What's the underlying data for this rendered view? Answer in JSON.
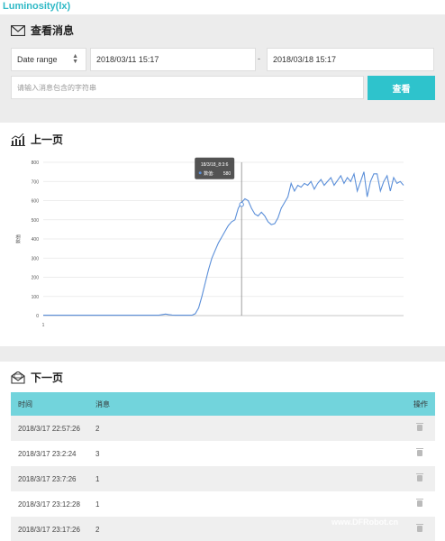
{
  "app_title": "Luminosity(lx)",
  "filter": {
    "title": "查看消息",
    "range_label": "Date range",
    "date_from": "2018/03/11 15:17",
    "separator": "-",
    "date_to": "2018/03/18 15:17",
    "search_placeholder": "请输入消息包含的字符串",
    "search_button": "查看"
  },
  "chart_section": {
    "title": "上一页"
  },
  "chart_data": {
    "type": "line",
    "ylabel": "数值",
    "ylim": [
      0,
      800
    ],
    "yticks": [
      0,
      100,
      200,
      300,
      400,
      500,
      600,
      700,
      800
    ],
    "x_tick_label": "1",
    "series": [
      {
        "name": "数值",
        "values": [
          2,
          2,
          2,
          2,
          2,
          2,
          2,
          2,
          2,
          2,
          2,
          2,
          2,
          2,
          2,
          2,
          2,
          2,
          2,
          2,
          2,
          2,
          2,
          2,
          2,
          2,
          2,
          2,
          2,
          2,
          2,
          2,
          2,
          2,
          2,
          2,
          5,
          8,
          5,
          3,
          2,
          2,
          2,
          2,
          2,
          2,
          10,
          40,
          100,
          170,
          240,
          300,
          340,
          380,
          410,
          440,
          470,
          490,
          500,
          560,
          590,
          610,
          600,
          560,
          530,
          520,
          540,
          520,
          490,
          475,
          480,
          510,
          560,
          590,
          620,
          690,
          650,
          680,
          670,
          690,
          680,
          700,
          660,
          690,
          710,
          680,
          700,
          720,
          680,
          705,
          730,
          690,
          720,
          700,
          740,
          650,
          700,
          750,
          620,
          700,
          740,
          740,
          650,
          700,
          730,
          650,
          720,
          690,
          700,
          680
        ]
      }
    ],
    "tooltip": {
      "date": "18/3/18_8:3:6",
      "series": "数值",
      "value": "580"
    },
    "tooltip_index": 60,
    "grid": true
  },
  "messages": {
    "title": "下一页",
    "columns": [
      "时间",
      "消息",
      "操作"
    ],
    "rows": [
      {
        "time": "2018/3/17 22:57:26",
        "msg": "2"
      },
      {
        "time": "2018/3/17 23:2:24",
        "msg": "3"
      },
      {
        "time": "2018/3/17 23:7:26",
        "msg": "1"
      },
      {
        "time": "2018/3/17 23:12:28",
        "msg": "1"
      },
      {
        "time": "2018/3/17 23:17:26",
        "msg": "2"
      }
    ]
  },
  "watermark": "www.DFRobot.cn",
  "colors": {
    "accent": "#2ec3cc",
    "table_header": "#72d4dc",
    "title": "#2fb9c6",
    "line": "#5b8fd9"
  }
}
